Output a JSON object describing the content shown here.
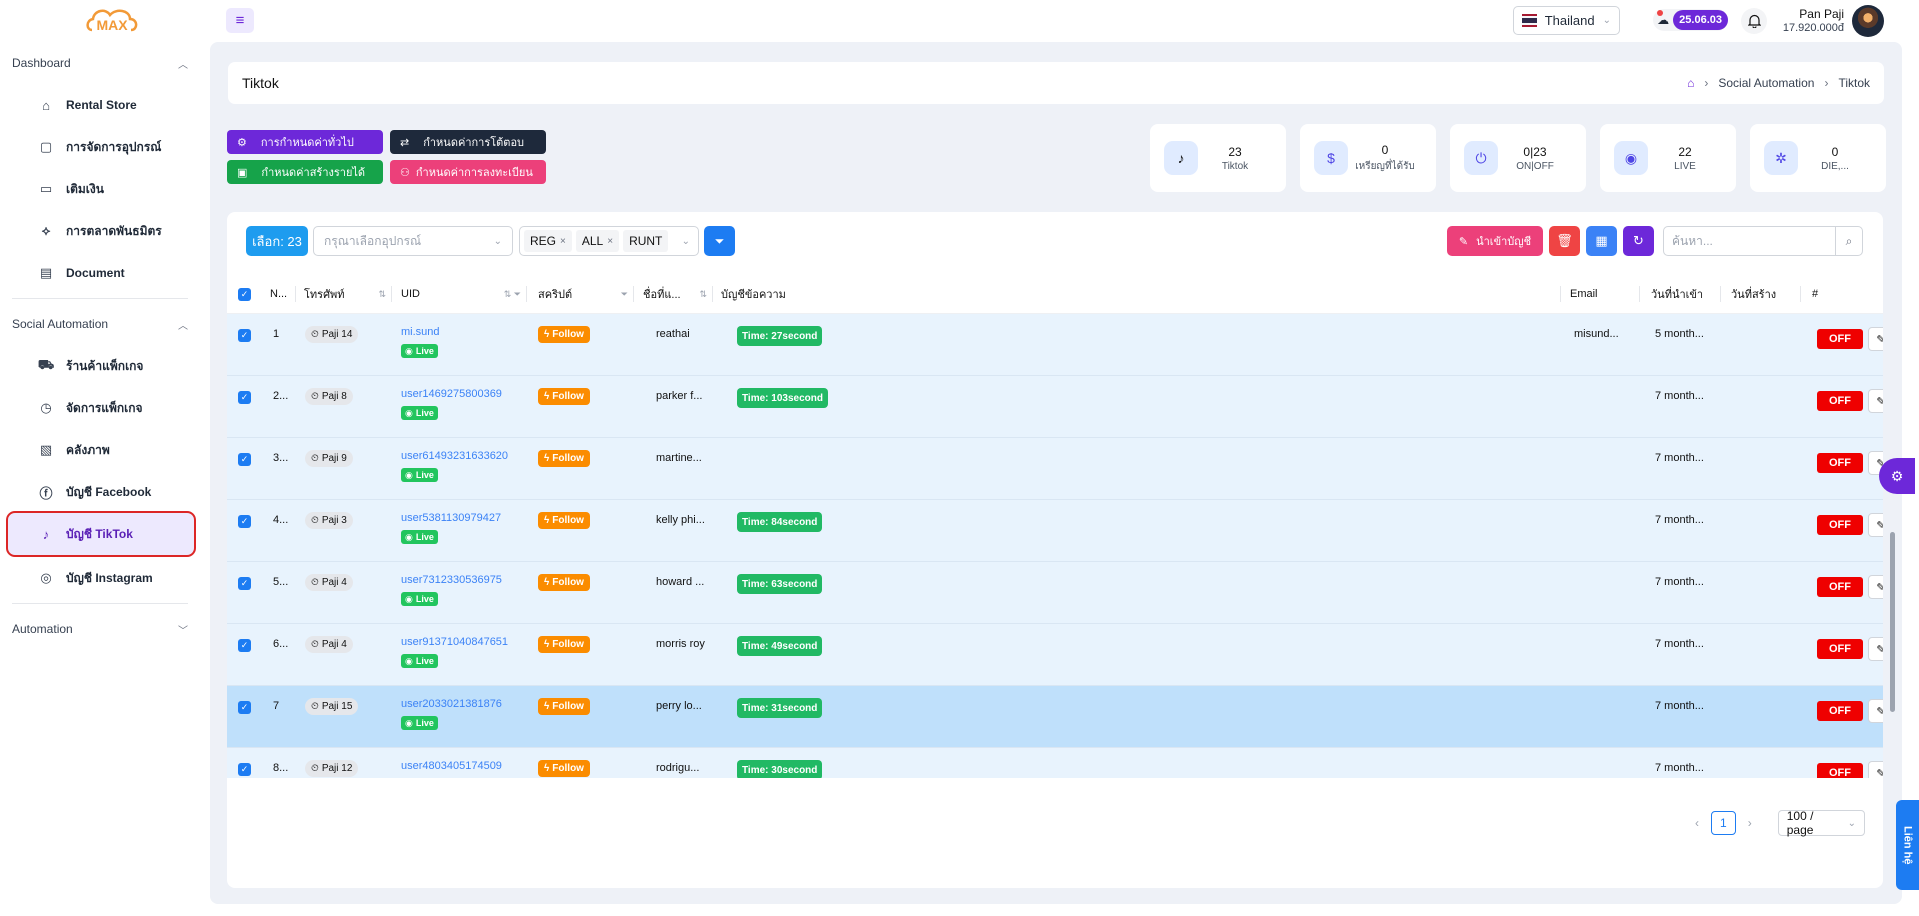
{
  "header": {
    "logo_text": "MAX",
    "country": "Thailand",
    "version": "25.06.03",
    "user_name": "Pan Paji",
    "balance": "17.920.000đ"
  },
  "sidebar": {
    "sections": [
      {
        "label": "Dashboard",
        "items": [
          {
            "label": "Rental Store",
            "icon": "store-icon"
          },
          {
            "label": "การจัดการอุปกรณ์",
            "icon": "device-icon"
          },
          {
            "label": "เติมเงิน",
            "icon": "card-icon"
          },
          {
            "label": "การตลาดพันธมิตร",
            "icon": "affiliate-icon"
          },
          {
            "label": "Document",
            "icon": "document-icon"
          }
        ]
      },
      {
        "label": "Social Automation",
        "items": [
          {
            "label": "ร้านค้าแพ็กเกจ",
            "icon": "cart-icon"
          },
          {
            "label": "จัดการแพ็กเกจ",
            "icon": "history-icon"
          },
          {
            "label": "คลังภาพ",
            "icon": "file-icon"
          },
          {
            "label": "บัญชี Facebook",
            "icon": "facebook-icon"
          },
          {
            "label": "บัญชี TikTok",
            "icon": "tiktok-icon",
            "active": true
          },
          {
            "label": "บัญชี Instagram",
            "icon": "instagram-icon"
          }
        ]
      },
      {
        "label": "Automation",
        "items": []
      }
    ]
  },
  "page": {
    "title": "Tiktok",
    "breadcrumb": [
      "Social Automation",
      "Tiktok"
    ]
  },
  "actions": {
    "general_settings": "การกำหนดค่าทั่วไป",
    "interaction_settings": "กำหนดค่าการโต้ตอบ",
    "income_settings": "กำหนดค่าสร้างรายได้",
    "register_settings": "กำหนดค่าการลงทะเบียน"
  },
  "stats": [
    {
      "value": "23",
      "label": "Tiktok",
      "icon": "tiktok-icon"
    },
    {
      "value": "0",
      "label": "เหรียญที่ได้รับ",
      "icon": "dollar-icon"
    },
    {
      "value": "0|23",
      "label": "ON|OFF",
      "icon": "power-icon"
    },
    {
      "value": "22",
      "label": "LIVE",
      "icon": "broadcast-icon"
    },
    {
      "value": "0",
      "label": "DIE,...",
      "icon": "bug-icon"
    }
  ],
  "toolbar": {
    "selected": "เลือก: 23",
    "device_placeholder": "กรุณาเลือกอุปกรณ์",
    "tags": [
      "REG",
      "ALL",
      "RUNT"
    ],
    "import_label": "นำเข้าบัญชี",
    "search_placeholder": "ค้นหา..."
  },
  "table": {
    "columns": [
      "N...",
      "โทรศัพท์",
      "UID",
      "สคริปต์",
      "ชื่อที่แ...",
      "บัญชีข้อความ",
      "Email",
      "วันที่นำเข้า",
      "วันที่สร้าง",
      "#"
    ],
    "rows": [
      {
        "no": "1",
        "phone": "Paji 14",
        "uid": "mi.sund",
        "status": "Live",
        "script": "Follow",
        "name": "reathai",
        "time": "Time: 27second",
        "email": "misund...",
        "imported": "5 month...",
        "toggle": "OFF"
      },
      {
        "no": "2...",
        "phone": "Paji 8",
        "uid": "user1469275800369",
        "status": "Live",
        "script": "Follow",
        "name": "parker f...",
        "time": "Time: 103second",
        "email": "",
        "imported": "7 month...",
        "toggle": "OFF"
      },
      {
        "no": "3...",
        "phone": "Paji 9",
        "uid": "user61493231633620",
        "status": "Live",
        "script": "Follow",
        "name": "martine...",
        "time": "",
        "email": "",
        "imported": "7 month...",
        "toggle": "OFF"
      },
      {
        "no": "4...",
        "phone": "Paji 3",
        "uid": "user5381130979427",
        "status": "Live",
        "script": "Follow",
        "name": "kelly phi...",
        "time": "Time: 84second",
        "email": "",
        "imported": "7 month...",
        "toggle": "OFF"
      },
      {
        "no": "5...",
        "phone": "Paji 4",
        "uid": "user7312330536975",
        "status": "Live",
        "script": "Follow",
        "name": "howard ...",
        "time": "Time: 63second",
        "email": "",
        "imported": "7 month...",
        "toggle": "OFF"
      },
      {
        "no": "6...",
        "phone": "Paji 4",
        "uid": "user91371040847651",
        "status": "Live",
        "script": "Follow",
        "name": "morris roy",
        "time": "Time: 49second",
        "email": "",
        "imported": "7 month...",
        "toggle": "OFF"
      },
      {
        "no": "7",
        "phone": "Paji 15",
        "uid": "user2033021381876",
        "status": "Live",
        "script": "Follow",
        "name": "perry lo...",
        "time": "Time: 31second",
        "email": "",
        "imported": "7 month...",
        "toggle": "OFF",
        "highlight": true
      },
      {
        "no": "8...",
        "phone": "Paji 12",
        "uid": "user4803405174509",
        "status": "Live",
        "script": "Follow",
        "name": "rodrigu...",
        "time": "Time: 30second",
        "email": "",
        "imported": "7 month...",
        "toggle": "OFF"
      }
    ]
  },
  "pagination": {
    "current": "1",
    "page_size": "100 / page"
  },
  "contact_label": "Liên hệ",
  "colors": {
    "accent": "#6d28d9",
    "primary": "#1d7cf2",
    "off": "#ef0000",
    "live": "#22c55e",
    "follow": "#fb8c00"
  }
}
